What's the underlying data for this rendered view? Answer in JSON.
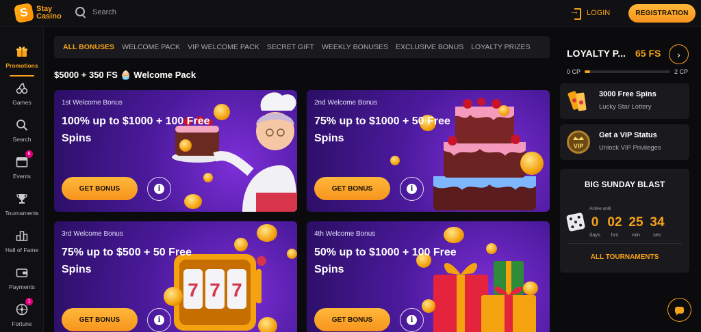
{
  "brand": {
    "line1": "Stay",
    "line2": "Casino",
    "accent": "#f7a21b"
  },
  "header": {
    "search_placeholder": "Search",
    "login_label": "LOGIN",
    "registration_label": "REGISTRATION"
  },
  "sidebar": {
    "items": [
      {
        "label": "Promotions",
        "icon": "gift-icon",
        "active": true
      },
      {
        "label": "Games",
        "icon": "cherries-icon"
      },
      {
        "label": "Search",
        "icon": "search-icon"
      },
      {
        "label": "Events",
        "icon": "calendar-icon",
        "badge": "6"
      },
      {
        "label": "Tournaments",
        "icon": "trophy-icon"
      },
      {
        "label": "Hall of Fame",
        "icon": "podium-icon"
      },
      {
        "label": "Payments",
        "icon": "wallet-icon"
      },
      {
        "label": "Fortune",
        "icon": "wheel-icon",
        "badge": "1"
      }
    ]
  },
  "tabs": [
    "ALL BONUSES",
    "WELCOME PACK",
    "VIP WELCOME PACK",
    "SECRET GIFT",
    "WEEKLY BONUSES",
    "EXCLUSIVE BONUS",
    "LOYALTY PRIZES"
  ],
  "section_title": "$5000 + 350 FS 🧁 Welcome Pack",
  "bonuses": [
    {
      "subtitle": "1st Welcome Bonus",
      "title": "100% up to $1000 + 100 Free Spins",
      "cta": "GET BONUS",
      "art": "chef-with-cake"
    },
    {
      "subtitle": "2nd Welcome Bonus",
      "title": "75% up to $1000 + 50 Free Spins",
      "cta": "GET BONUS",
      "art": "tiered-cake"
    },
    {
      "subtitle": "3rd Welcome Bonus",
      "title": "75% up to $500 + 50 Free Spins",
      "cta": "GET BONUS",
      "art": "slot-machine-777"
    },
    {
      "subtitle": "4th Welcome Bonus",
      "title": "50% up to $1000 + 100 Free Spins",
      "cta": "GET BONUS",
      "art": "gift-boxes"
    }
  ],
  "loyalty": {
    "label": "LOYALTY P...",
    "free_spins": "65 FS",
    "cp_start": "0 CP",
    "cp_end": "2 CP",
    "progress": 0.06
  },
  "promos": [
    {
      "title": "3000 Free Spins",
      "subtitle": "Lucky Star Lottery",
      "icon": "lottery-tickets-icon"
    },
    {
      "title": "Get a VIP Status",
      "subtitle": "Unlock VIP Privileges",
      "icon": "vip-crown-icon"
    }
  ],
  "tournament": {
    "title": "BIG SUNDAY BLAST",
    "active_until": "Active until",
    "countdown": [
      {
        "value": "0",
        "unit": "days"
      },
      {
        "value": "02",
        "unit": "hrs"
      },
      {
        "value": "25",
        "unit": "min"
      },
      {
        "value": "34",
        "unit": "sec"
      }
    ],
    "all_label": "ALL TOURNAMENTS"
  }
}
